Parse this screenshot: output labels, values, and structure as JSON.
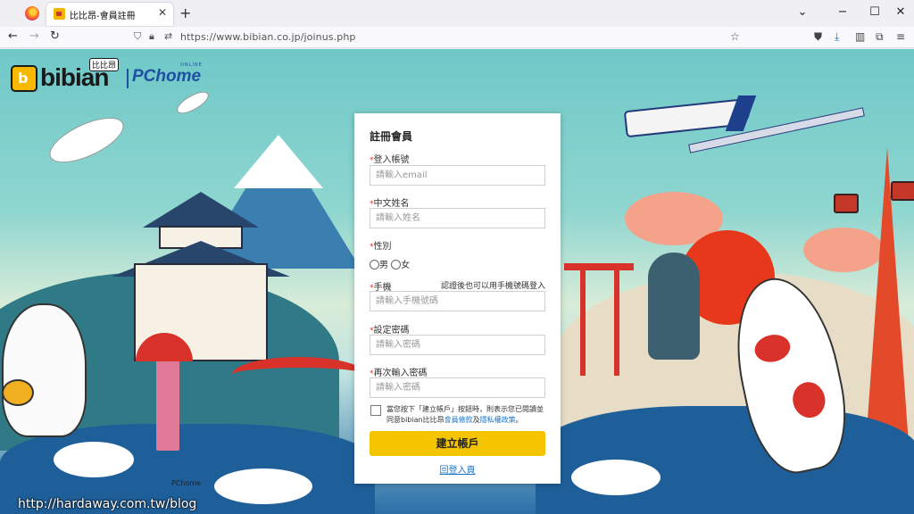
{
  "browser": {
    "tab_title": "比比昂-會員註冊",
    "tab_close": "✕",
    "new_tab": "+",
    "url": "https://www.bibian.co.jp/joinus.php",
    "window_controls": {
      "minimize": "−",
      "maximize": "☐",
      "close": "✕"
    },
    "nav": {
      "back": "←",
      "forward": "→",
      "reload": "↻"
    },
    "icons": {
      "shield": "⛉",
      "lock": "🔒︎",
      "permissions": "⇄",
      "bookmark": "☆",
      "pocket": "⛊",
      "download": "⤓",
      "sidebar": "▥",
      "extensions": "⧉",
      "menu": "≡",
      "list_all_tabs": "⌄"
    }
  },
  "logo": {
    "brand": "bibian",
    "brand_cn": "比比昂",
    "partner": "PChome",
    "partner_tag": "ONLINE"
  },
  "form": {
    "title": "註冊會員",
    "required_mark": "*",
    "account": {
      "label": "登入帳號",
      "placeholder": "請輸入email"
    },
    "name": {
      "label": "中文姓名",
      "placeholder": "請輸入姓名"
    },
    "gender": {
      "label": "性別",
      "options": [
        "男",
        "女"
      ]
    },
    "phone": {
      "label": "手機",
      "hint": "認證後也可以用手機號碼登入",
      "placeholder": "請輸入手機號碼"
    },
    "password": {
      "label": "設定密碼",
      "placeholder": "請輸入密碼"
    },
    "password_confirm": {
      "label": "再次輸入密碼",
      "placeholder": "請輸入密碼"
    },
    "terms": {
      "text_before": "當您按下「建立帳戶」按鈕時，則表示您已閱讀並同意bibian比比昂",
      "terms_link": "會員條款",
      "joiner": "及",
      "privacy_link": "隱私權政策",
      "text_after": "。"
    },
    "submit_label": "建立帳戶",
    "back_link": "回登入頁"
  },
  "page": {
    "pchome_credit": "PChome",
    "watermark": "http://hardaway.com.tw/blog"
  },
  "colors": {
    "accent_button": "#f5c400",
    "required": "#e0352b",
    "link": "#1a73c8",
    "sun": "#e8381c"
  }
}
